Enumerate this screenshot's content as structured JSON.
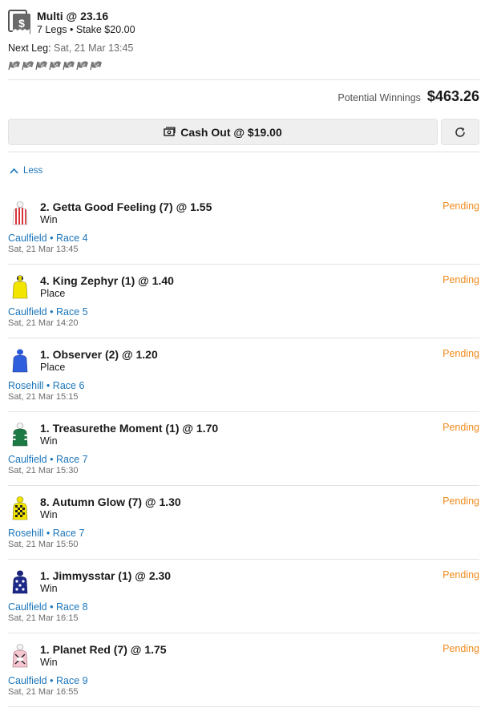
{
  "bet": {
    "icon": "cash-bet-icon",
    "title": "Multi @ 23.16",
    "subtitle": "7 Legs • Stake $20.00",
    "next_leg_label": "Next Leg:",
    "next_leg_value": "Sat, 21 Mar 13:45",
    "flag_icon": "checkered-flag-icon",
    "flag_count": 7
  },
  "potential": {
    "label": "Potential Winnings",
    "amount": "$463.26"
  },
  "cashout": {
    "label": "Cash Out @ $19.00",
    "icon": "cash-out-icon",
    "refresh_icon": "refresh-icon"
  },
  "toggle": {
    "label": "Less",
    "icon": "chevron-up-icon"
  },
  "colors": {
    "link": "#1b75bb",
    "pending": "#f08a1c",
    "muted": "#6b6b6b"
  },
  "legs": [
    {
      "title": "2. Getta Good Feeling (7) @ 1.55",
      "type": "Win",
      "status": "Pending",
      "venue": "Caulfield • Race 4",
      "time": "Sat, 21 Mar 13:45",
      "silk": "silk-red-white-stripes-icon"
    },
    {
      "title": "4. King Zephyr (1) @ 1.40",
      "type": "Place",
      "status": "Pending",
      "venue": "Caulfield • Race 5",
      "time": "Sat, 21 Mar 14:20",
      "silk": "silk-yellow-icon"
    },
    {
      "title": "1. Observer (2) @ 1.20",
      "type": "Place",
      "status": "Pending",
      "venue": "Rosehill • Race 6",
      "time": "Sat, 21 Mar 15:15",
      "silk": "silk-blue-icon"
    },
    {
      "title": "1. Treasurethe Moment (1) @ 1.70",
      "type": "Win",
      "status": "Pending",
      "venue": "Caulfield • Race 7",
      "time": "Sat, 21 Mar 15:30",
      "silk": "silk-green-white-icon"
    },
    {
      "title": "8. Autumn Glow (7) @ 1.30",
      "type": "Win",
      "status": "Pending",
      "venue": "Rosehill • Race 7",
      "time": "Sat, 21 Mar 15:50",
      "silk": "silk-yellow-checks-icon"
    },
    {
      "title": "1. Jimmysstar (1) @ 2.30",
      "type": "Win",
      "status": "Pending",
      "venue": "Caulfield • Race 8",
      "time": "Sat, 21 Mar 16:15",
      "silk": "silk-navy-stars-icon"
    },
    {
      "title": "1. Planet Red (7) @ 1.75",
      "type": "Win",
      "status": "Pending",
      "venue": "Caulfield • Race 9",
      "time": "Sat, 21 Mar 16:55",
      "silk": "silk-pink-white-icon"
    }
  ]
}
